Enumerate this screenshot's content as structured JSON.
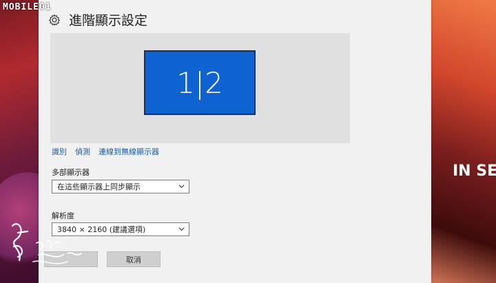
{
  "watermark": {
    "top_text": "MOBILE01"
  },
  "background": {
    "right_banner": "IN SE"
  },
  "settings": {
    "title": "進階顯示設定",
    "monitor_label": "1|2",
    "links": [
      "識別",
      "偵測",
      "連線到無線顯示器"
    ],
    "multiple_displays": {
      "label": "多部顯示器",
      "value": "在這些顯示器上同步顯示"
    },
    "resolution": {
      "label": "解析度",
      "value": "3840 × 2160 (建議選項)"
    },
    "buttons": {
      "apply": "",
      "cancel": "取消"
    }
  },
  "colors": {
    "monitor_blue": "#0e62d1",
    "link_blue": "#1c5ea8",
    "window_bg": "#f1f1f1"
  },
  "icons": [
    "gear-icon",
    "chevron-down-icon"
  ]
}
